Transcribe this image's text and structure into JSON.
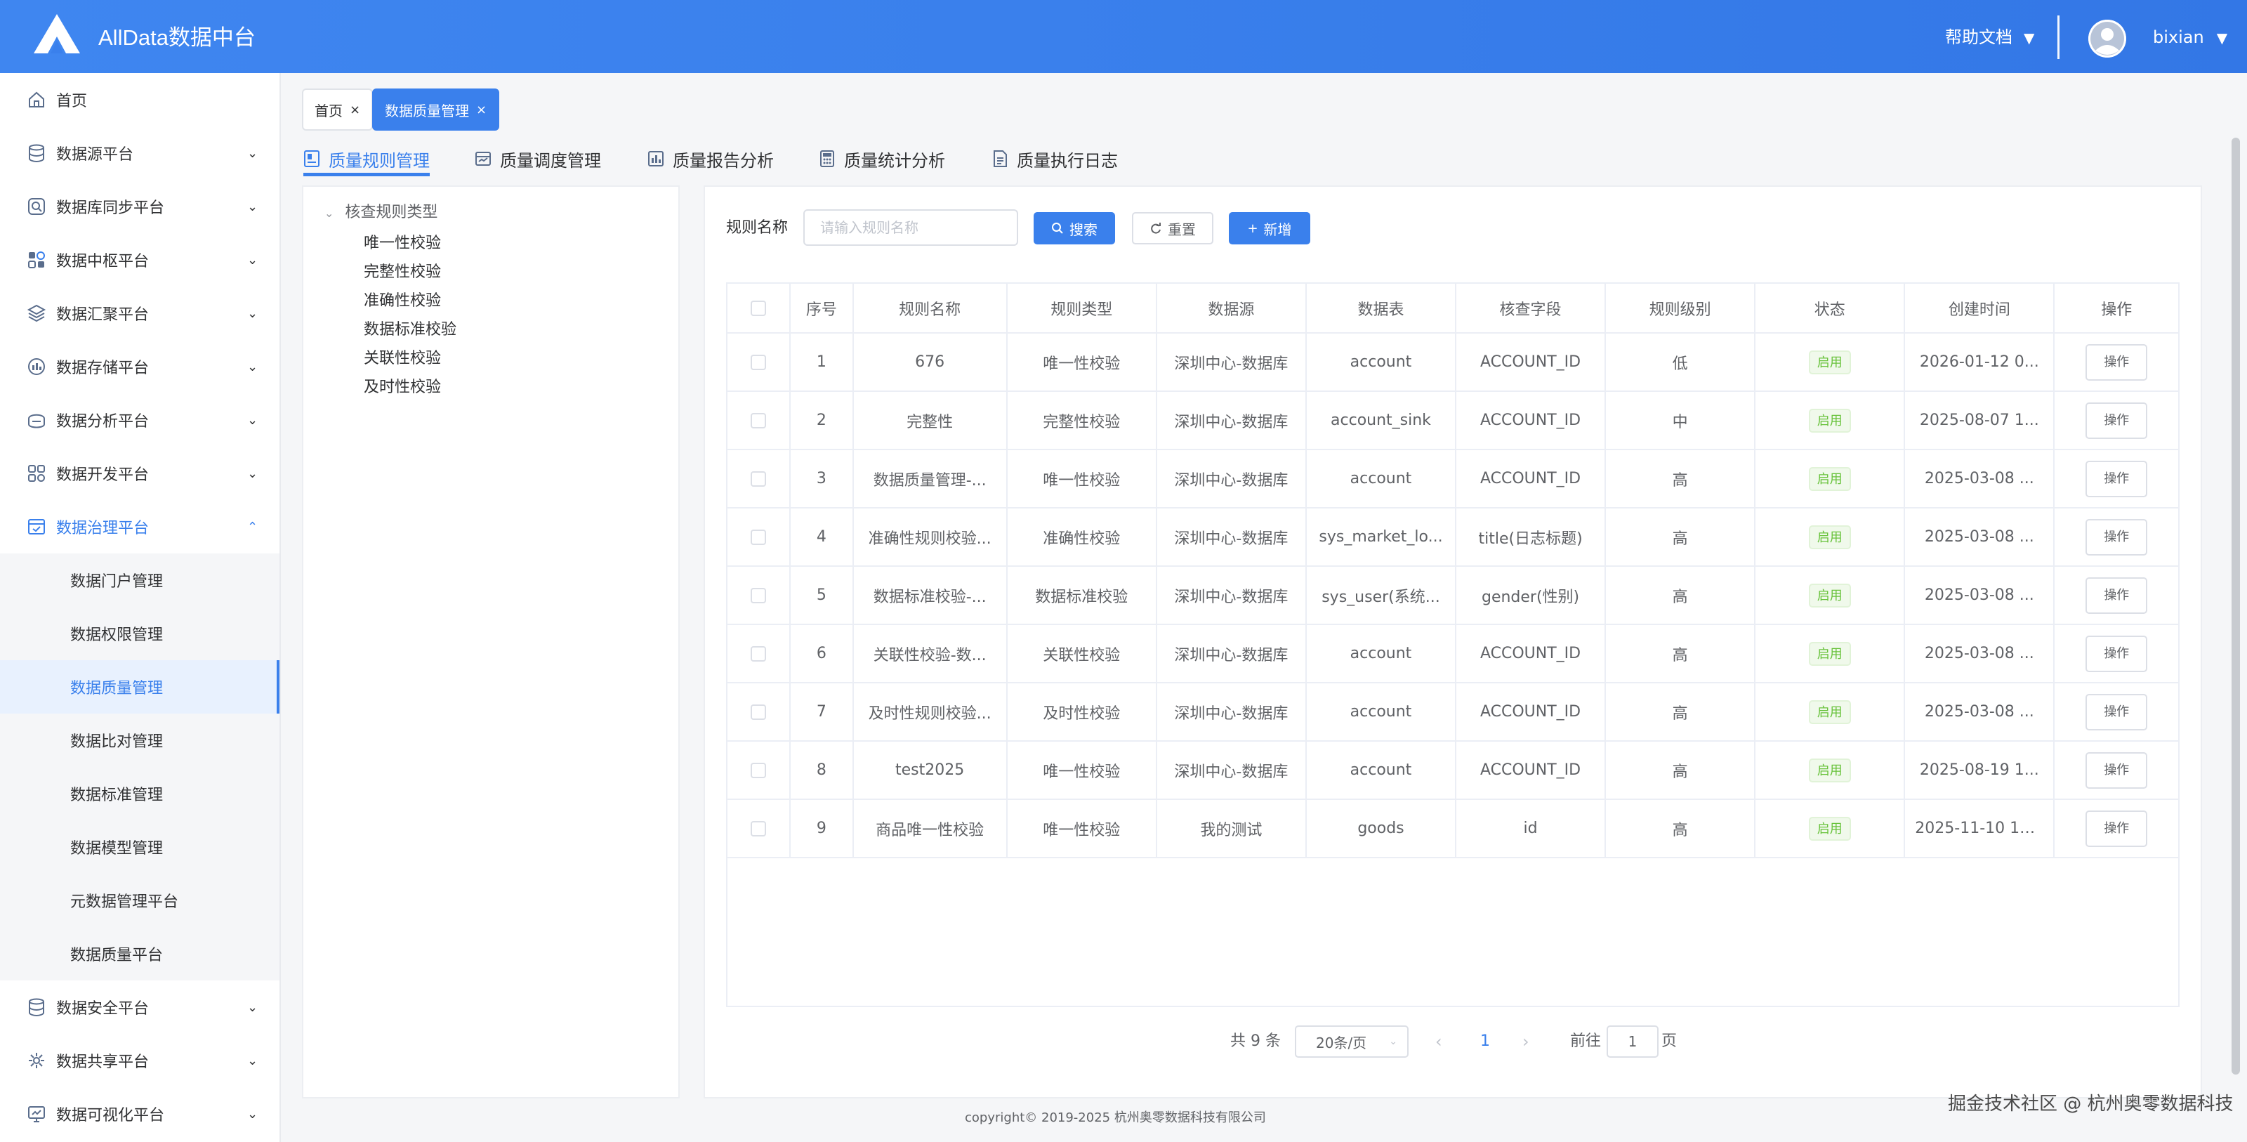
{
  "header": {
    "title": "AllData数据中台",
    "help_label": "帮助文档",
    "user_name": "bixian",
    "dropdown_caret": "▼"
  },
  "sidebar": {
    "items": [
      {
        "label": "首页",
        "icon": "home-icon",
        "has_children": false
      },
      {
        "label": "数据源平台",
        "icon": "database-icon",
        "has_children": true
      },
      {
        "label": "数据库同步平台",
        "icon": "sync-icon",
        "has_children": true
      },
      {
        "label": "数据中枢平台",
        "icon": "hub-icon",
        "has_children": true
      },
      {
        "label": "数据汇聚平台",
        "icon": "layers-icon",
        "has_children": true
      },
      {
        "label": "数据存储平台",
        "icon": "storage-icon",
        "has_children": true
      },
      {
        "label": "数据分析平台",
        "icon": "analysis-icon",
        "has_children": true
      },
      {
        "label": "数据开发平台",
        "icon": "develop-icon",
        "has_children": true
      },
      {
        "label": "数据治理平台",
        "icon": "governance-icon",
        "has_children": true,
        "expanded": true
      },
      {
        "label": "数据安全平台",
        "icon": "security-icon",
        "has_children": true
      },
      {
        "label": "数据共享平台",
        "icon": "share-icon",
        "has_children": true
      },
      {
        "label": "数据可视化平台",
        "icon": "visualization-icon",
        "has_children": true
      }
    ],
    "governance_children": [
      {
        "label": "数据门户管理"
      },
      {
        "label": "数据权限管理"
      },
      {
        "label": "数据质量管理",
        "active": true
      },
      {
        "label": "数据比对管理"
      },
      {
        "label": "数据标准管理"
      },
      {
        "label": "数据模型管理"
      },
      {
        "label": "元数据管理平台"
      },
      {
        "label": "数据质量平台"
      }
    ]
  },
  "tags": [
    {
      "label": "首页",
      "close": "×"
    },
    {
      "label": "数据质量管理",
      "close": "×",
      "active": true
    }
  ],
  "module_tabs": [
    {
      "label": "质量规则管理",
      "icon": "rule-doc-icon",
      "active": true
    },
    {
      "label": "质量调度管理",
      "icon": "schedule-icon"
    },
    {
      "label": "质量报告分析",
      "icon": "report-chart-icon"
    },
    {
      "label": "质量统计分析",
      "icon": "calculator-icon"
    },
    {
      "label": "质量执行日志",
      "icon": "log-file-icon"
    }
  ],
  "tree": {
    "root": "核查规则类型",
    "children": [
      "唯一性校验",
      "完整性校验",
      "准确性校验",
      "数据标准校验",
      "关联性校验",
      "及时性校验"
    ]
  },
  "filter": {
    "label": "规则名称",
    "placeholder": "请输入规则名称",
    "search_label": "搜索",
    "reset_label": "重置",
    "add_label": "新增"
  },
  "table": {
    "columns": [
      "序号",
      "规则名称",
      "规则类型",
      "数据源",
      "数据表",
      "核查字段",
      "规则级别",
      "状态",
      "创建时间",
      "操作"
    ],
    "rows": [
      {
        "no": "1",
        "name": "676",
        "type": "唯一性校验",
        "source": "深圳中心-数据库",
        "table": "account",
        "field": "ACCOUNT_ID",
        "level": "低",
        "status": "启用",
        "created": "2026-01-12 0...",
        "op": "操作"
      },
      {
        "no": "2",
        "name": "完整性",
        "type": "完整性校验",
        "source": "深圳中心-数据库",
        "table": "account_sink",
        "field": "ACCOUNT_ID",
        "level": "中",
        "status": "启用",
        "created": "2025-08-07 1...",
        "op": "操作"
      },
      {
        "no": "3",
        "name": "数据质量管理-...",
        "type": "唯一性校验",
        "source": "深圳中心-数据库",
        "table": "account",
        "field": "ACCOUNT_ID",
        "level": "高",
        "status": "启用",
        "created": "2025-03-08 ...",
        "op": "操作"
      },
      {
        "no": "4",
        "name": "准确性规则校验...",
        "type": "准确性校验",
        "source": "深圳中心-数据库",
        "table": "sys_market_lo...",
        "field": "title(日志标题)",
        "level": "高",
        "status": "启用",
        "created": "2025-03-08 ...",
        "op": "操作"
      },
      {
        "no": "5",
        "name": "数据标准校验-...",
        "type": "数据标准校验",
        "source": "深圳中心-数据库",
        "table": "sys_user(系统...",
        "field": "gender(性别)",
        "level": "高",
        "status": "启用",
        "created": "2025-03-08 ...",
        "op": "操作"
      },
      {
        "no": "6",
        "name": "关联性校验-数...",
        "type": "关联性校验",
        "source": "深圳中心-数据库",
        "table": "account",
        "field": "ACCOUNT_ID",
        "level": "高",
        "status": "启用",
        "created": "2025-03-08 ...",
        "op": "操作"
      },
      {
        "no": "7",
        "name": "及时性规则校验...",
        "type": "及时性校验",
        "source": "深圳中心-数据库",
        "table": "account",
        "field": "ACCOUNT_ID",
        "level": "高",
        "status": "启用",
        "created": "2025-03-08 ...",
        "op": "操作"
      },
      {
        "no": "8",
        "name": "test2025",
        "type": "唯一性校验",
        "source": "深圳中心-数据库",
        "table": "account",
        "field": "ACCOUNT_ID",
        "level": "高",
        "status": "启用",
        "created": "2025-08-19 1...",
        "op": "操作"
      },
      {
        "no": "9",
        "name": "商品唯一性校验",
        "type": "唯一性校验",
        "source": "我的测试",
        "table": "goods",
        "field": "id",
        "level": "高",
        "status": "启用",
        "created": "2025-11-10 10...",
        "op": "操作"
      }
    ]
  },
  "pagination": {
    "total_text": "共 9 条",
    "page_size": "20条/页",
    "prev": "‹",
    "current_page": "1",
    "next": "›",
    "goto_label": "前往",
    "goto_value": "1",
    "page_suffix": "页"
  },
  "footer": {
    "copyright": "copyright© 2019-2025 杭州奥零数据科技有限公司",
    "watermark": "掘金技术社区 @ 杭州奥零数据科技"
  },
  "colors": {
    "primary": "#3a80ec",
    "header_bg": "#3a80ec",
    "status_green": "#67c23a"
  }
}
